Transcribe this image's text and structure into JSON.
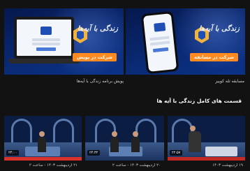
{
  "banners": [
    {
      "ribbon": "شرکت در پویش",
      "brand_title": "زندگی با آیه‌ها",
      "caption": "پویش برنامه زندگی با آیه‌ها"
    },
    {
      "ribbon": "شرکت در مسابقه",
      "brand_title": "زندگی با آیه‌ها",
      "caption": "مسابقه تله کوییز"
    }
  ],
  "section": {
    "title": "قسمت های کامل زندگی با آیه ها",
    "chevron": "‹"
  },
  "episodes": [
    {
      "duration": "۲۴:۰۰",
      "date": "۲۱ اردیبهشت ۱۴۰۳ - ساعت ۲"
    },
    {
      "duration": "۲۴:۳۲",
      "date": "۲۰ اردیبهشت ۱۴۰۳ - ساعت ۲"
    },
    {
      "duration": "۲۲:۵۷",
      "date": "۱۹ اردیبهشت ۱۴۰۳"
    }
  ],
  "colors": {
    "ribbon": "#ff8a1f",
    "banner": "#0a2a74",
    "background": "#121212"
  }
}
